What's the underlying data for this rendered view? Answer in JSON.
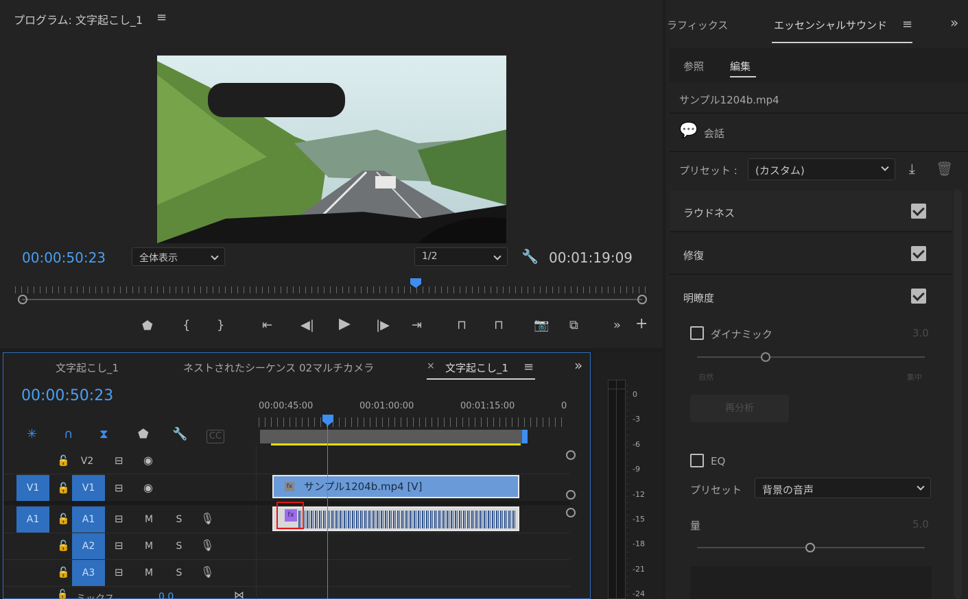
{
  "program_monitor": {
    "title": "プログラム: 文字起こし_1",
    "timecode_current": "00:00:50:23",
    "timecode_duration": "00:01:19:09",
    "zoom_select": "全体表示",
    "resolution_select": "1/2"
  },
  "essential_sound": {
    "tab_graphics": "ラフィックス",
    "tab_essential": "エッセンシャルサウンド",
    "subtab_browse": "参照",
    "subtab_edit": "編集",
    "clip_name": "サンプル1204b.mp4",
    "type_label": "会話",
    "preset_label": "プリセット :",
    "preset_value": "(カスタム)",
    "loudness": "ラウドネス",
    "repair": "修復",
    "clarity": "明瞭度",
    "dynamics_label": "ダイナミック",
    "dynamics_value": "3.0",
    "slider_left": "自然",
    "slider_right": "集中",
    "reanalyze": "再分析",
    "eq_label": "EQ",
    "eq_preset_label": "プリセット",
    "eq_preset_value": "背景の音声",
    "amount_label": "量",
    "amount_value": "5.0"
  },
  "timeline": {
    "tab1": "文字起こし_1",
    "tab2": "ネストされたシーケンス 02マルチカメラ",
    "tab3": "文字起こし_1",
    "tab3_close": "×",
    "timecode": "00:00:50:23",
    "ruler": [
      "00:00:45:00",
      "00:01:00:00",
      "00:01:15:00",
      "0"
    ],
    "tracks": {
      "v2": "V2",
      "v1_src": "V1",
      "v1": "V1",
      "a1_src": "A1",
      "a1": "A1",
      "a2": "A2",
      "a3": "A3",
      "m": "M",
      "s": "S",
      "mix": "ミックス",
      "mix_value": "0.0"
    },
    "video_clip": "サンプル1204b.mp4 [V]",
    "fx_badge": "fx"
  },
  "meter_scale": [
    "0",
    "-3",
    "-6",
    "-9",
    "-12",
    "-15",
    "-18",
    "-21",
    "-24"
  ]
}
